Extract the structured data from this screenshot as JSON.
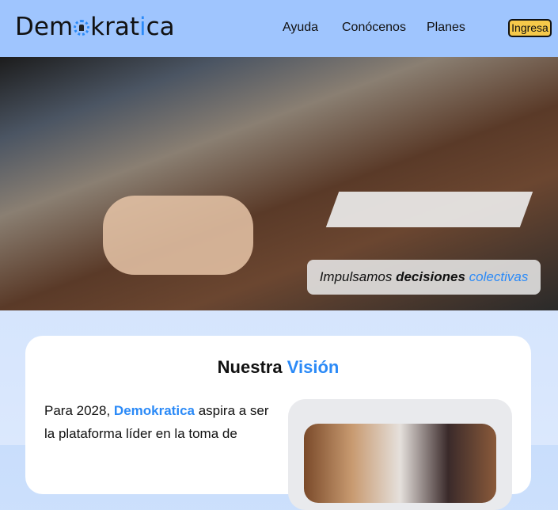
{
  "nav": {
    "logo_prefix": "Dem",
    "logo_middle": "kra",
    "logo_t": "t",
    "logo_i": "i",
    "logo_suffix": "ca",
    "links": [
      "Ayuda",
      "Conócenos",
      "Planes"
    ],
    "login": "Ingresa"
  },
  "hero": {
    "caption_1": "Impulsamos",
    "caption_2": "decisiones",
    "caption_3": "colectivas"
  },
  "vision": {
    "title_1": "Nuestra",
    "title_2": "Visión",
    "text_1": "Para 2028,",
    "brand": "Demokratica",
    "text_2": "aspira a ser la plataforma líder en la toma de"
  }
}
